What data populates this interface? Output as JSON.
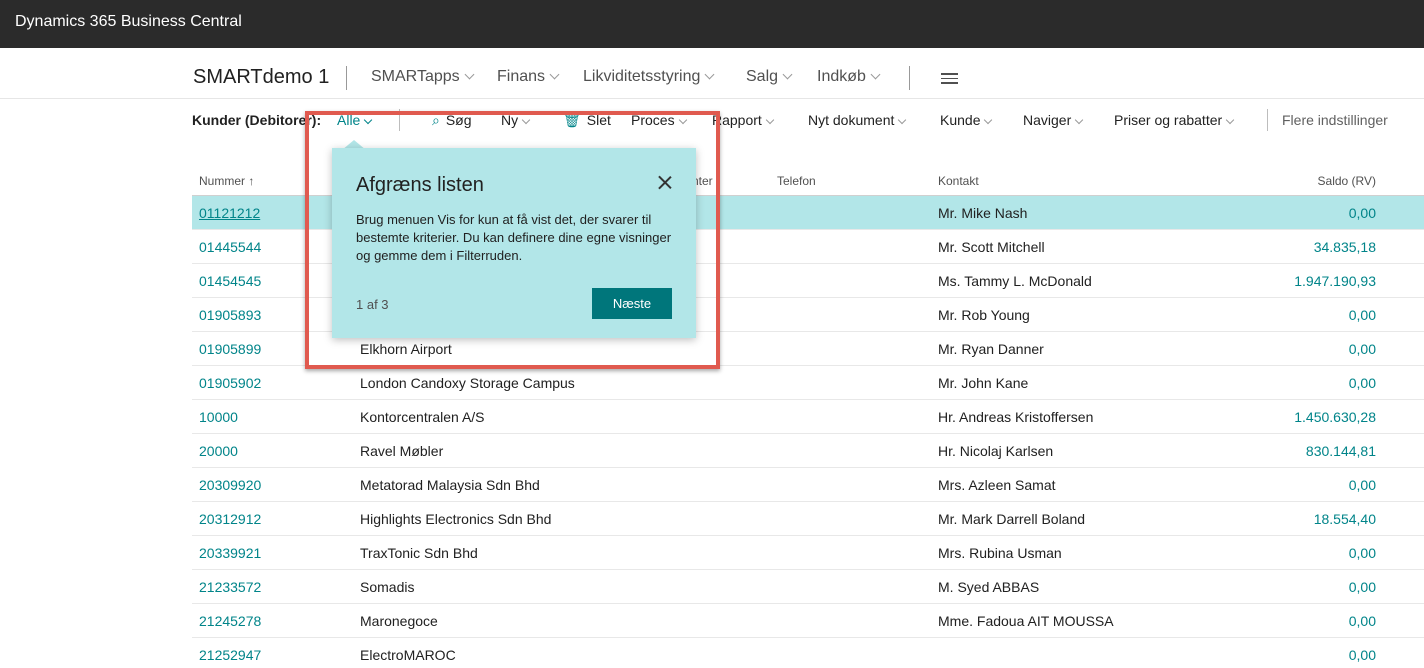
{
  "app": {
    "title": "Dynamics 365 Business Central"
  },
  "nav": {
    "company": "SMARTdemo 1",
    "items": [
      "SMARTapps",
      "Finans",
      "Likviditetsstyring",
      "Salg",
      "Indkøb"
    ]
  },
  "actions": {
    "page_title": "Kunder (Debitorer):",
    "view": "Alle",
    "search": "Søg",
    "new": "Ny",
    "delete": "Slet",
    "process": "Proces",
    "report": "Rapport",
    "new_document": "Nyt dokument",
    "customer": "Kunde",
    "navigate": "Naviger",
    "prices": "Priser og rabatter",
    "more": "Flere indstillinger"
  },
  "table": {
    "headers": {
      "number": "Nummer ↑",
      "partial": "nter",
      "phone": "Telefon",
      "contact": "Kontakt",
      "balance": "Saldo (RV)"
    },
    "rows": [
      {
        "number": "01121212",
        "name": "",
        "contact": "Mr. Mike Nash",
        "balance": "0,00"
      },
      {
        "number": "01445544",
        "name": "",
        "contact": "Mr. Scott Mitchell",
        "balance": "34.835,18"
      },
      {
        "number": "01454545",
        "name": "",
        "contact": "Ms. Tammy L. McDonald",
        "balance": "1.947.190,93"
      },
      {
        "number": "01905893",
        "name": "",
        "contact": "Mr. Rob Young",
        "balance": "0,00"
      },
      {
        "number": "01905899",
        "name": "Elkhorn Airport",
        "contact": "Mr. Ryan Danner",
        "balance": "0,00"
      },
      {
        "number": "01905902",
        "name": "London Candoxy Storage Campus",
        "contact": "Mr. John Kane",
        "balance": "0,00"
      },
      {
        "number": "10000",
        "name": "Kontorcentralen A/S",
        "contact": "Hr. Andreas Kristoffersen",
        "balance": "1.450.630,28"
      },
      {
        "number": "20000",
        "name": "Ravel Møbler",
        "contact": "Hr. Nicolaj Karlsen",
        "balance": "830.144,81"
      },
      {
        "number": "20309920",
        "name": "Metatorad Malaysia Sdn Bhd",
        "contact": "Mrs. Azleen Samat",
        "balance": "0,00"
      },
      {
        "number": "20312912",
        "name": "Highlights Electronics Sdn Bhd",
        "contact": "Mr. Mark Darrell Boland",
        "balance": "18.554,40"
      },
      {
        "number": "20339921",
        "name": "TraxTonic Sdn Bhd",
        "contact": "Mrs. Rubina Usman",
        "balance": "0,00"
      },
      {
        "number": "21233572",
        "name": "Somadis",
        "contact": "M. Syed ABBAS",
        "balance": "0,00"
      },
      {
        "number": "21245278",
        "name": "Maronegoce",
        "contact": "Mme. Fadoua AIT MOUSSA",
        "balance": "0,00"
      },
      {
        "number": "21252947",
        "name": "ElectroMAROC",
        "contact": "",
        "balance": "0,00"
      }
    ]
  },
  "teaching_tip": {
    "title": "Afgræns listen",
    "body": "Brug menuen Vis for kun at få vist det, der svarer til bestemte kriterier. Du kan definere dine egne visninger og gemme dem i Filterruden.",
    "step": "1 af 3",
    "next": "Næste"
  },
  "colors": {
    "accent": "#008489",
    "topbar": "#2b2b2b",
    "tip_background": "#b2e6e8",
    "highlight_border": "#e05a4f",
    "next_button": "#00767b"
  }
}
